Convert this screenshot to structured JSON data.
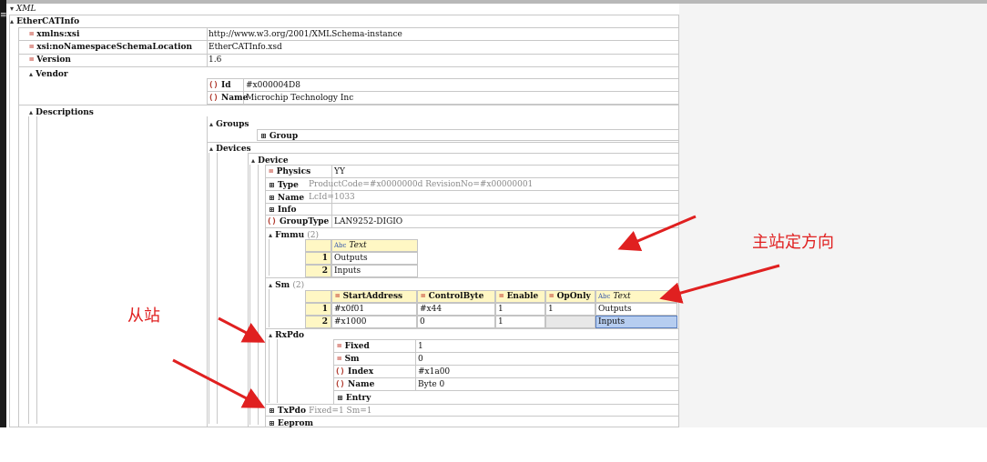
{
  "tree": {
    "root_label": "XML",
    "root_element": "EtherCATInfo",
    "attrs": [
      {
        "name": "xmlns:xsi",
        "value": "http://www.w3.org/2001/XMLSchema-instance"
      },
      {
        "name": "xsi:noNamespaceSchemaLocation",
        "value": "EtherCATInfo.xsd"
      },
      {
        "name": "Version",
        "value": "1.6"
      }
    ],
    "vendor": {
      "label": "Vendor",
      "id_label": "Id",
      "id_value": "#x000004D8",
      "name_label": "Name",
      "name_value": "Microchip Technology Inc"
    },
    "descriptions": {
      "label": "Descriptions",
      "groups_label": "Groups",
      "group_label": "Group",
      "devices_label": "Devices",
      "device_label": "Device",
      "device": {
        "physics_label": "Physics",
        "physics_value": "YY",
        "type_label": "Type",
        "type_value": "ProductCode=#x0000000d RevisionNo=#x00000001",
        "name_label": "Name",
        "name_value": "LcId=1033",
        "info_label": "Info",
        "grouptype_label": "GroupType",
        "grouptype_value": "LAN9252-DIGIO",
        "fmmu_label": "Fmmu",
        "fmmu_count": "(2)",
        "fmmu_header": "Text",
        "fmmu_rows": [
          {
            "num": "1",
            "text": "Outputs"
          },
          {
            "num": "2",
            "text": "Inputs"
          }
        ],
        "sm_label": "Sm",
        "sm_count": "(2)",
        "sm_headers": [
          "StartAddress",
          "ControlByte",
          "Enable",
          "OpOnly",
          "Text"
        ],
        "sm_rows": [
          {
            "num": "1",
            "cells": [
              "#x0f01",
              "#x44",
              "1",
              "1",
              "Outputs"
            ]
          },
          {
            "num": "2",
            "cells": [
              "#x1000",
              "0",
              "1",
              "",
              "Inputs"
            ]
          }
        ],
        "rxpdo_label": "RxPdo",
        "rxpdo": {
          "fixed_label": "Fixed",
          "fixed_value": "1",
          "sm_label": "Sm",
          "sm_value": "0",
          "index_label": "Index",
          "index_value": "#x1a00",
          "name_label": "Name",
          "name_value": "Byte 0",
          "entry_label": "Entry"
        },
        "txpdo_label": "TxPdo",
        "txpdo_summary": "Fixed=1 Sm=1",
        "eeprom_label": "Eeprom"
      }
    }
  },
  "annotations": {
    "master": "主站定方向",
    "slave": "从站"
  },
  "colors": {
    "annotation": "#e02020",
    "header_yellow": "#fff7c4",
    "selection": "#b6cdf0"
  }
}
